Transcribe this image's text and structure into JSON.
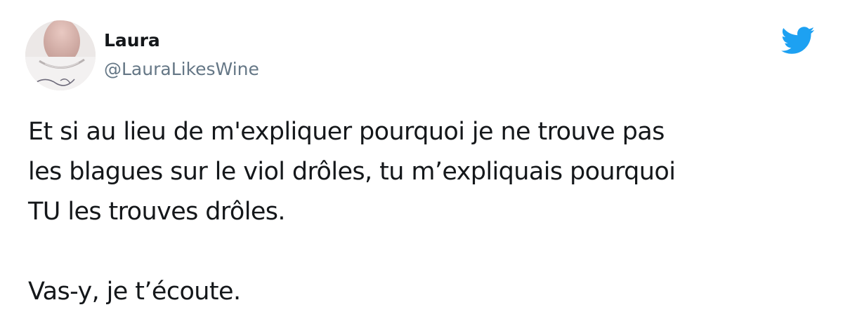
{
  "tweet": {
    "author": {
      "display_name": "Laura",
      "handle": "@LauraLikesWine",
      "avatar_icon": "profile-photo"
    },
    "platform_icon": "twitter-bird-icon",
    "brand_color": "#1da1f2",
    "paragraphs": [
      "Et si au lieu de m'expliquer pourquoi je ne trouve pas\nles blagues sur le viol drôles, tu m’expliquais pourquoi\nTU les trouves drôles.",
      "Vas-y, je t’écoute."
    ]
  }
}
